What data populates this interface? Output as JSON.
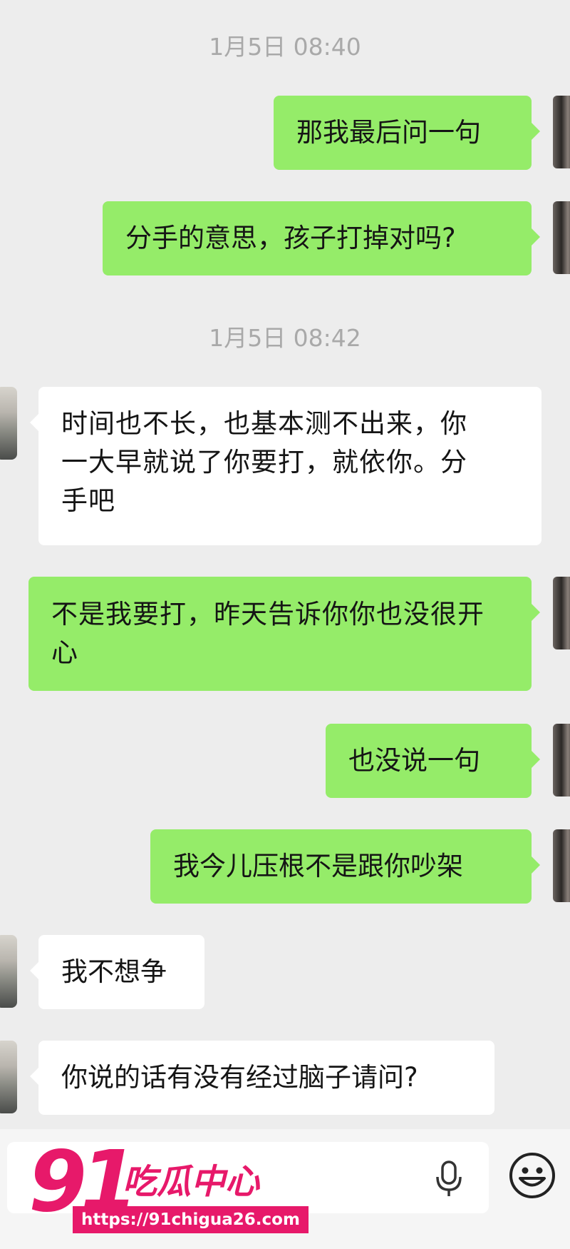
{
  "conversation": {
    "timestamps": [
      "1月5日 08:40",
      "1月5日 08:42"
    ],
    "messages": [
      {
        "from": "me",
        "text": "那我最后问一句"
      },
      {
        "from": "me",
        "text": "分手的意思，孩子打掉对吗?"
      },
      {
        "from": "them",
        "text": "时间也不长，也基本测不出来，你一大早就说了你要打，就依你。分手吧"
      },
      {
        "from": "me",
        "text": "不是我要打，昨天告诉你你也没很开心"
      },
      {
        "from": "me",
        "text": "也没说一句"
      },
      {
        "from": "me",
        "text": "我今儿压根不是跟你吵架"
      },
      {
        "from": "them",
        "text": "我不想争"
      },
      {
        "from": "them",
        "text": "你说的话有没有经过脑子请问?"
      }
    ]
  },
  "input_bar": {
    "mic_icon": "microphone-icon",
    "emoji_icon": "smiley-face-icon"
  },
  "watermark": {
    "number": "91",
    "title": "吃瓜中心",
    "url": "https://91chigua26.com",
    "color": "#e7196a"
  },
  "colors": {
    "background": "#ededed",
    "sent_bubble": "#95ec69",
    "received_bubble": "#ffffff",
    "timestamp": "#a9a9a9"
  }
}
